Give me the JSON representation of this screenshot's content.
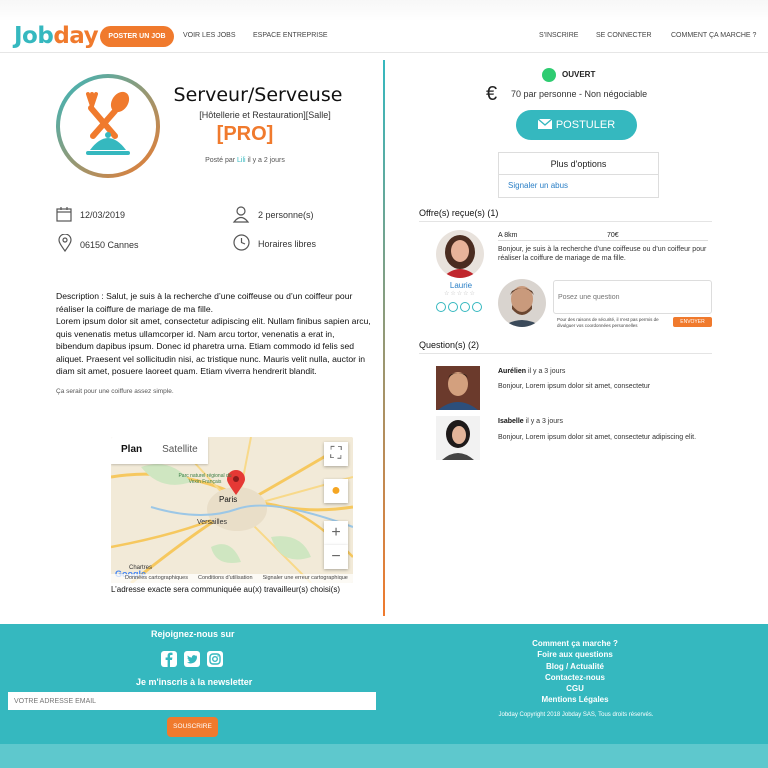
{
  "header": {
    "logo_part1": "Job",
    "logo_part2": "day",
    "post_button": "POSTER UN JOB",
    "nav_left": [
      "VOIR LES JOBS",
      "ESPACE ENTREPRISE"
    ],
    "nav_right": [
      "S'INSCRIRE",
      "SE CONNECTER",
      "COMMENT ÇA MARCHE ?"
    ]
  },
  "job": {
    "title": "Serveur/Serveuse",
    "category": "[Hôtellerie et Restauration][Salle]",
    "badge": "[PRO]",
    "posted_prefix": "Posté par",
    "posted_user": "Lili",
    "posted_suffix": "il y a 2 jours",
    "date": "12/03/2019",
    "persons": "2 personne(s)",
    "location": "06150 Cannes",
    "schedule": "Horaires libres",
    "description": "Description : Salut, je suis à la recherche d’une coiffeuse ou d’un coiffeur pour réaliser la coiffure de mariage de ma fille.\nLorem ipsum dolor sit amet, consectetur adipiscing elit. Nullam finibus sapien arcu, quis venenatis metus ullamcorper id. Nam arcu tortor, venenatis a erat in, bibendum dapibus ipsum. Donec id pharetra urna. Etiam commodo id felis sed aliquet. Praesent vel sollicitudin nisi, ac tristique nunc. Mauris velit nulla, auctor in diam sit amet, posuere laoreet quam. Etiam viverra hendrerit blandit.",
    "note": "Ça serait pour une coiffure assez simple."
  },
  "map": {
    "tab_plan": "Plan",
    "tab_satellite": "Satellite",
    "city_paris": "Paris",
    "city_versailles": "Versailles",
    "park_label": "Parc naturel régional du Vexin Français",
    "footer_data": "Données cartographiques",
    "footer_terms": "Conditions d'utilisation",
    "footer_report": "Signaler une erreur cartographique",
    "google": "Google",
    "chartres": "Chartres",
    "note": "L’adresse exacte sera communiquée au(x) travailleur(s) choisi(s)"
  },
  "sidebar": {
    "status": "OUVERT",
    "currency_symbol": "€",
    "price": "70 par personne - Non négociable",
    "apply_button": "POSTULER",
    "options_title": "Plus d'options",
    "report_link": "Signaler un abus",
    "offers_title": "Offre(s) reçue(s) (1)",
    "offer": {
      "distance": "A 8km",
      "amount": "70€",
      "text": "Bonjour, je suis à la recherche d’une coiffeuse ou d’un coiffeur pour réaliser la coiffure de mariage de ma fille.",
      "name": "Laurie",
      "stars": "☆☆☆☆☆"
    },
    "question_placeholder": "Posez une question",
    "question_warning": "Pour des raisons de sécurité, il n'est pas permis de divulguer vos coordonnées personnelles",
    "send_button": "ENVOYER",
    "questions_title": "Question(s) (2)",
    "questions": [
      {
        "name": "Aurélien",
        "time": "il y a 3 jours",
        "text": "Bonjour, Lorem ipsum dolor sit amet, consectetur"
      },
      {
        "name": "Isabelle",
        "time": "il y a 3 jours",
        "text": "Bonjour, Lorem ipsum dolor sit amet, consectetur adipiscing elit."
      }
    ]
  },
  "footer": {
    "join_title": "Rejoignez-nous sur",
    "newsletter_title": "Je m'inscris à la newsletter",
    "email_placeholder": "VOTRE ADRESSE EMAIL",
    "subscribe_button": "SOUSCRIRE",
    "links": [
      "Comment ça marche ?",
      "Foire aux questions",
      "Blog / Actualité",
      "Contactez-nous",
      "CGU",
      "Mentions Légales"
    ],
    "copyright": "Jobday Copyright 2018 Jobday SAS, Tous droits réservés."
  },
  "colors": {
    "brand_teal": "#35b8bf",
    "brand_orange": "#f07a2d",
    "status_green": "#2ecc71",
    "link_blue": "#2a7fc6"
  },
  "icons": [
    "utensils-icon",
    "calendar-icon",
    "person-icon",
    "location-pin-icon",
    "clock-icon",
    "euro-icon",
    "envelope-icon",
    "facebook-icon",
    "twitter-icon",
    "instagram-icon"
  ]
}
